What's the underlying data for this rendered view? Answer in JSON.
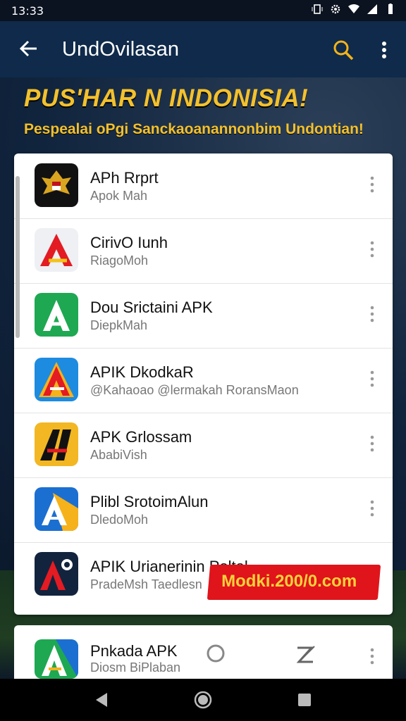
{
  "status_bar": {
    "time": "13:33"
  },
  "app_bar": {
    "title": "UndOvilasan"
  },
  "hero": {
    "title": "PUS'HAR N  INDONISIA!",
    "subtitle": "Pespealai oPgi Sanckaoanannonbim Undontian!"
  },
  "apps": [
    {
      "name": "APh Rrprt",
      "sub": "Apok Mah",
      "icon": "garuda-emblem-icon"
    },
    {
      "name": "CirivO Iunh",
      "sub": "RiagoMoh",
      "icon": "red-a-logo-icon"
    },
    {
      "name": "Dou Srictaini APK",
      "sub": "DiepkMah",
      "icon": "green-a-logo-icon"
    },
    {
      "name": "APIK DkodkaR",
      "sub": "@Kahaoao @lermakah RoransMaon",
      "icon": "blue-a-logo-icon"
    },
    {
      "name": "APK Grlossam",
      "sub": "AbabiVish",
      "icon": "yellow-a-logo-icon"
    },
    {
      "name": "Plibl SrotoimAlun",
      "sub": "DledoMoh",
      "icon": "blue-a-logo-icon"
    },
    {
      "name": "APIK Urianerinin Poltal",
      "sub": "PradeMsh Taedlesn",
      "icon": "dark-red-a-logo-icon"
    }
  ],
  "promo": {
    "text": "Modki.200/0.com"
  },
  "featured": {
    "name": "Pnkada APK",
    "sub": "Diosm BiPlaban"
  },
  "colors": {
    "app_bar": "#0f2a4a",
    "hero_text": "#f3c12d",
    "promo_bg": "#e0141b",
    "promo_text": "#ffd23a",
    "search_icon": "#f3b21b"
  }
}
